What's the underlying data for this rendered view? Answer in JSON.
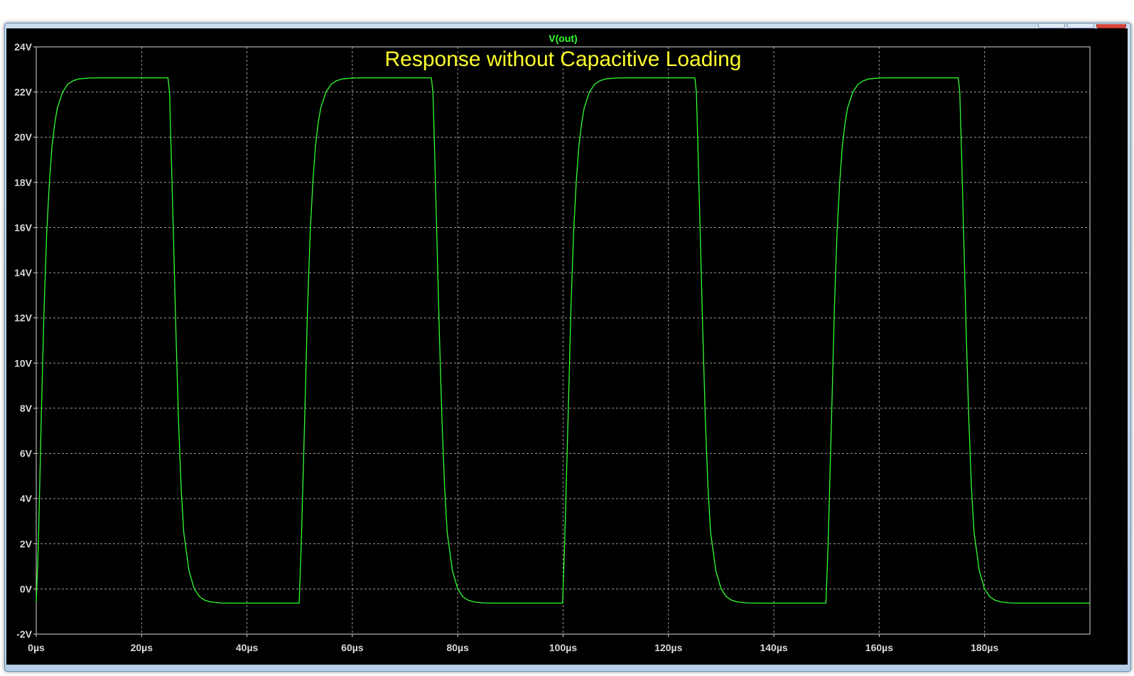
{
  "window": {
    "controls": [
      "minimize",
      "maximize",
      "close"
    ]
  },
  "colors": {
    "background": "#000000",
    "grid": "#9a9a9a",
    "axis_text": "#d8d8d8",
    "trace": "#33ff33",
    "title": "#ffff2e"
  },
  "chart_data": {
    "type": "line",
    "title": "Response without Capacitive Loading",
    "xlabel": "",
    "ylabel": "",
    "xlim": [
      0,
      200
    ],
    "ylim": [
      -2,
      24
    ],
    "grid": true,
    "x_ticks": [
      0,
      20,
      40,
      60,
      80,
      100,
      120,
      140,
      160,
      180
    ],
    "x_tick_labels": [
      "0µs",
      "20µs",
      "40µs",
      "60µs",
      "80µs",
      "100µs",
      "120µs",
      "140µs",
      "160µs",
      "180µs"
    ],
    "y_ticks": [
      -2,
      0,
      2,
      4,
      6,
      8,
      10,
      12,
      14,
      16,
      18,
      20,
      22,
      24
    ],
    "y_tick_labels": [
      "-2V",
      "0V",
      "2V",
      "4V",
      "6V",
      "8V",
      "10V",
      "12V",
      "14V",
      "16V",
      "18V",
      "20V",
      "22V",
      "24V"
    ],
    "series": [
      {
        "name": "V(out)",
        "color": "#33ff33",
        "x": [
          0.0,
          0.4,
          1.0,
          1.5,
          2.0,
          2.5,
          3.0,
          3.5,
          4.0,
          5.0,
          6.0,
          7.0,
          8.0,
          10.0,
          12.0,
          15.0,
          20.0,
          25.0,
          25.3,
          25.6,
          26.0,
          26.5,
          27.0,
          27.5,
          28.0,
          29.0,
          30.0,
          31.0,
          32.0,
          33.0,
          34.0,
          35.0,
          37.0,
          40.0,
          45.0,
          49.9,
          50.3,
          51.0,
          51.5,
          52.0,
          52.5,
          53.0,
          53.5,
          54.0,
          55.0,
          56.0,
          57.0,
          58.0,
          60.0,
          62.0,
          65.0,
          70.0,
          75.0,
          75.3,
          75.6,
          76.0,
          76.5,
          77.0,
          77.5,
          78.0,
          79.0,
          80.0,
          81.0,
          82.0,
          83.0,
          84.0,
          85.0,
          87.0,
          90.0,
          95.0,
          99.9,
          100.3,
          101.0,
          101.5,
          102.0,
          102.5,
          103.0,
          103.5,
          104.0,
          105.0,
          106.0,
          107.0,
          108.0,
          110.0,
          112.0,
          115.0,
          120.0,
          125.0,
          125.3,
          125.6,
          126.0,
          126.5,
          127.0,
          127.5,
          128.0,
          129.0,
          130.0,
          131.0,
          132.0,
          133.0,
          134.0,
          135.0,
          137.0,
          140.0,
          145.0,
          149.9,
          150.3,
          151.0,
          151.5,
          152.0,
          152.5,
          153.0,
          153.5,
          154.0,
          155.0,
          156.0,
          157.0,
          158.0,
          160.0,
          162.0,
          165.0,
          170.0,
          175.0,
          175.3,
          175.6,
          176.0,
          176.5,
          177.0,
          177.5,
          178.0,
          179.0,
          180.0,
          181.0,
          182.0,
          183.0,
          184.0,
          185.0,
          187.0,
          190.0,
          195.0,
          200.0
        ],
        "values": [
          -0.6,
          2.0,
          8.0,
          12.5,
          15.8,
          18.0,
          19.6,
          20.6,
          21.3,
          22.0,
          22.35,
          22.5,
          22.58,
          22.62,
          22.63,
          22.63,
          22.63,
          22.63,
          22.0,
          19.5,
          16.0,
          11.5,
          7.5,
          4.5,
          2.5,
          0.8,
          0.0,
          -0.35,
          -0.5,
          -0.57,
          -0.6,
          -0.62,
          -0.63,
          -0.63,
          -0.63,
          -0.63,
          2.0,
          8.0,
          12.5,
          15.8,
          18.0,
          19.6,
          20.6,
          21.3,
          22.0,
          22.35,
          22.5,
          22.58,
          22.62,
          22.63,
          22.63,
          22.63,
          22.63,
          22.0,
          19.5,
          16.0,
          11.5,
          7.5,
          4.5,
          2.5,
          0.8,
          0.0,
          -0.35,
          -0.5,
          -0.57,
          -0.6,
          -0.62,
          -0.63,
          -0.63,
          -0.63,
          -0.63,
          2.0,
          8.0,
          12.5,
          15.8,
          18.0,
          19.6,
          20.6,
          21.3,
          22.0,
          22.35,
          22.5,
          22.58,
          22.62,
          22.63,
          22.63,
          22.63,
          22.63,
          22.0,
          19.5,
          16.0,
          11.5,
          7.5,
          4.5,
          2.5,
          0.8,
          0.0,
          -0.35,
          -0.5,
          -0.57,
          -0.6,
          -0.62,
          -0.63,
          -0.63,
          -0.63,
          -0.63,
          2.0,
          8.0,
          12.5,
          15.8,
          18.0,
          19.6,
          20.6,
          21.3,
          22.0,
          22.35,
          22.5,
          22.58,
          22.62,
          22.63,
          22.63,
          22.63,
          22.63,
          22.0,
          19.5,
          16.0,
          11.5,
          7.5,
          4.5,
          2.5,
          0.8,
          0.0,
          -0.35,
          -0.5,
          -0.57,
          -0.6,
          -0.62,
          -0.63,
          -0.63,
          -0.63,
          -0.63
        ]
      }
    ]
  }
}
